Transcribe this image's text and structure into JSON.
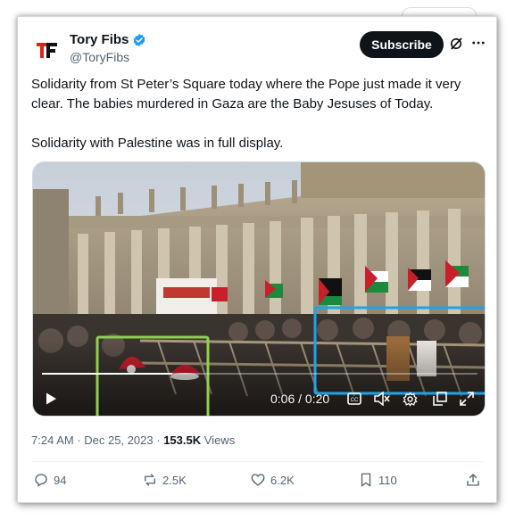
{
  "author": {
    "display_name": "Tory Fibs",
    "handle": "@ToryFibs",
    "avatar_text": "TF",
    "verified": true
  },
  "header": {
    "subscribe_label": "Subscribe",
    "grok_icon": "grok-icon",
    "more_icon": "more-icon"
  },
  "tweet": {
    "line1": "Solidarity from St Peter’s Square today where the Pope just made it very",
    "line2": "clear. The babies murdered in Gaza are the Baby Jesuses of Today.",
    "line3": "Solidarity with Palestine was in full display."
  },
  "video": {
    "time_readout": "0:06 / 0:20",
    "progress": 0.3,
    "highlight_colors": {
      "left": "#8fd14f",
      "right": "#1fa3e8"
    },
    "controls": [
      "play-icon",
      "captions-icon",
      "mute-icon",
      "settings-icon",
      "popout-icon",
      "fullscreen-icon"
    ]
  },
  "meta": {
    "time": "7:24 AM",
    "date": "Dec 25, 2023",
    "views_count": "153.5K",
    "views_label": "Views"
  },
  "actions": {
    "replies": "94",
    "reposts": "2.5K",
    "likes": "6.2K",
    "bookmarks": "110"
  },
  "colors": {
    "accent": "#1d9bf0",
    "text": "#0f1419",
    "muted": "#536471"
  }
}
